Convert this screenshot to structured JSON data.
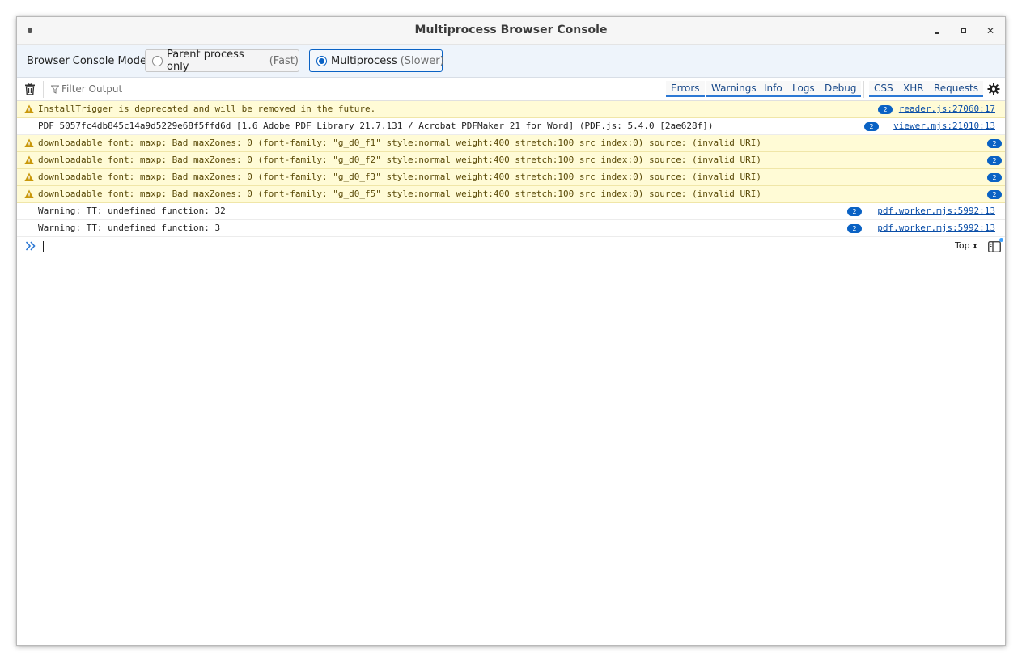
{
  "window": {
    "title": "Multiprocess Browser Console",
    "close_glyph": "✕"
  },
  "mode": {
    "label": "Browser Console Mode",
    "options": [
      {
        "label": "Parent process only",
        "hint": "(Fast)",
        "selected": false
      },
      {
        "label": "Multiprocess",
        "hint": "(Slower)",
        "selected": true
      }
    ]
  },
  "toolbar": {
    "filter_placeholder": "Filter Output",
    "filters": [
      "Errors",
      "Warnings",
      "Info",
      "Logs",
      "Debug"
    ],
    "net_filters": [
      "CSS",
      "XHR",
      "Requests"
    ],
    "icons": {
      "clear": "trash-icon",
      "filter": "funnel-icon",
      "settings": "gear-icon"
    }
  },
  "messages": [
    {
      "level": "warning",
      "text": "InstallTrigger is deprecated and will be removed in the future.",
      "count": "2",
      "location": "reader.js:27060:17"
    },
    {
      "level": "log",
      "text": "PDF 5057fc4db845c14a9d5229e68f5ffd6d [1.6 Adobe PDF Library 21.7.131 / Acrobat PDFMaker 21 for Word] (PDF.js: 5.4.0 [2ae628f])",
      "count": "2",
      "location": "viewer.mjs:21010:13"
    },
    {
      "level": "warning",
      "text": "downloadable font: maxp: Bad maxZones: 0 (font-family: \"g_d0_f1\" style:normal weight:400 stretch:100 src index:0) source: (invalid URI)",
      "count": "2",
      "location": ""
    },
    {
      "level": "warning",
      "text": "downloadable font: maxp: Bad maxZones: 0 (font-family: \"g_d0_f2\" style:normal weight:400 stretch:100 src index:0) source: (invalid URI)",
      "count": "2",
      "location": ""
    },
    {
      "level": "warning",
      "text": "downloadable font: maxp: Bad maxZones: 0 (font-family: \"g_d0_f3\" style:normal weight:400 stretch:100 src index:0) source: (invalid URI)",
      "count": "2",
      "location": ""
    },
    {
      "level": "warning",
      "text": "downloadable font: maxp: Bad maxZones: 0 (font-family: \"g_d0_f5\" style:normal weight:400 stretch:100 src index:0) source: (invalid URI)",
      "count": "2",
      "location": ""
    },
    {
      "level": "log",
      "text": "Warning: TT: undefined function: 32",
      "count": "2",
      "location": "pdf.worker.mjs:5992:13"
    },
    {
      "level": "log",
      "text": "Warning: TT: undefined function: 3",
      "count": "2",
      "location": "pdf.worker.mjs:5992:13"
    }
  ],
  "input": {
    "prompt_icon": "double-chevron-right-icon",
    "context": "Top",
    "context_arrows": "⬍"
  },
  "colors": {
    "accent": "#0a62c4",
    "warning_bg": "#fffbd6",
    "warning_text": "#5a4a08",
    "mode_bar_bg": "#eef4fb"
  }
}
